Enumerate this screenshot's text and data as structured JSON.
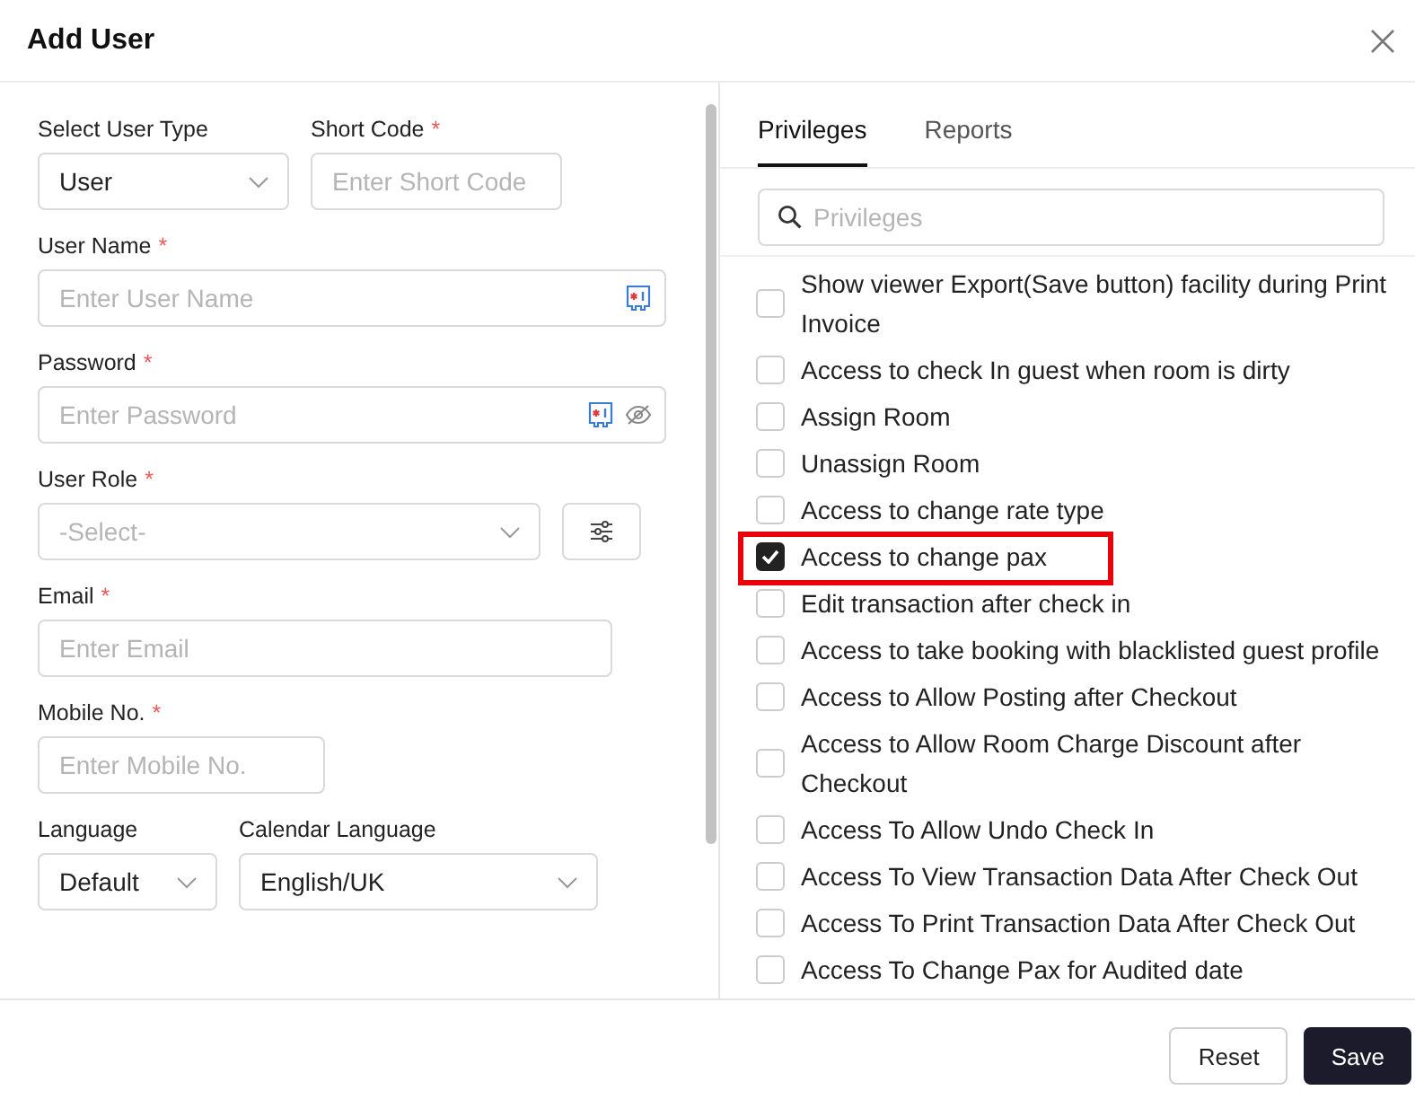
{
  "window": {
    "title": "Add User"
  },
  "form": {
    "user_type": {
      "label": "Select User Type",
      "value": "User"
    },
    "short_code": {
      "label": "Short Code",
      "required_mark": "*",
      "placeholder": "Enter Short Code"
    },
    "user_name": {
      "label": "User Name",
      "required_mark": "*",
      "placeholder": "Enter User Name"
    },
    "password": {
      "label": "Password",
      "required_mark": "*",
      "placeholder": "Enter Password"
    },
    "user_role": {
      "label": "User Role",
      "required_mark": "*",
      "placeholder": "-Select-"
    },
    "email": {
      "label": "Email",
      "required_mark": "*",
      "placeholder": "Enter Email"
    },
    "mobile": {
      "label": "Mobile No.",
      "required_mark": "*",
      "placeholder": "Enter Mobile No."
    },
    "language": {
      "label": "Language",
      "value": "Default"
    },
    "calendar_language": {
      "label": "Calendar Language",
      "value": "English/UK"
    }
  },
  "tabs": [
    {
      "label": "Privileges",
      "selected": true
    },
    {
      "label": "Reports",
      "selected": false
    }
  ],
  "search": {
    "placeholder": "Privileges"
  },
  "privileges": [
    {
      "label": "Show viewer Export(Save button) facility during Print Invoice",
      "checked": false
    },
    {
      "label": "Access to check In guest when room is dirty",
      "checked": false
    },
    {
      "label": "Assign Room",
      "checked": false
    },
    {
      "label": "Unassign Room",
      "checked": false
    },
    {
      "label": "Access to change rate type",
      "checked": false
    },
    {
      "label": "Access to change pax",
      "checked": true,
      "highlighted": true
    },
    {
      "label": "Edit transaction after check in",
      "checked": false
    },
    {
      "label": "Access to take booking with blacklisted guest profile",
      "checked": false
    },
    {
      "label": "Access to Allow Posting after Checkout",
      "checked": false
    },
    {
      "label": "Access to Allow Room Charge Discount after Checkout",
      "checked": false
    },
    {
      "label": "Access To Allow Undo Check In",
      "checked": false
    },
    {
      "label": "Access To View Transaction Data After Check Out",
      "checked": false
    },
    {
      "label": "Access To Print Transaction Data After Check Out",
      "checked": false
    },
    {
      "label": "Access To Change Pax for Audited date",
      "checked": false
    }
  ],
  "buttons": [
    {
      "label": "Reset",
      "kind": "secondary"
    },
    {
      "label": "Save",
      "kind": "primary"
    }
  ]
}
